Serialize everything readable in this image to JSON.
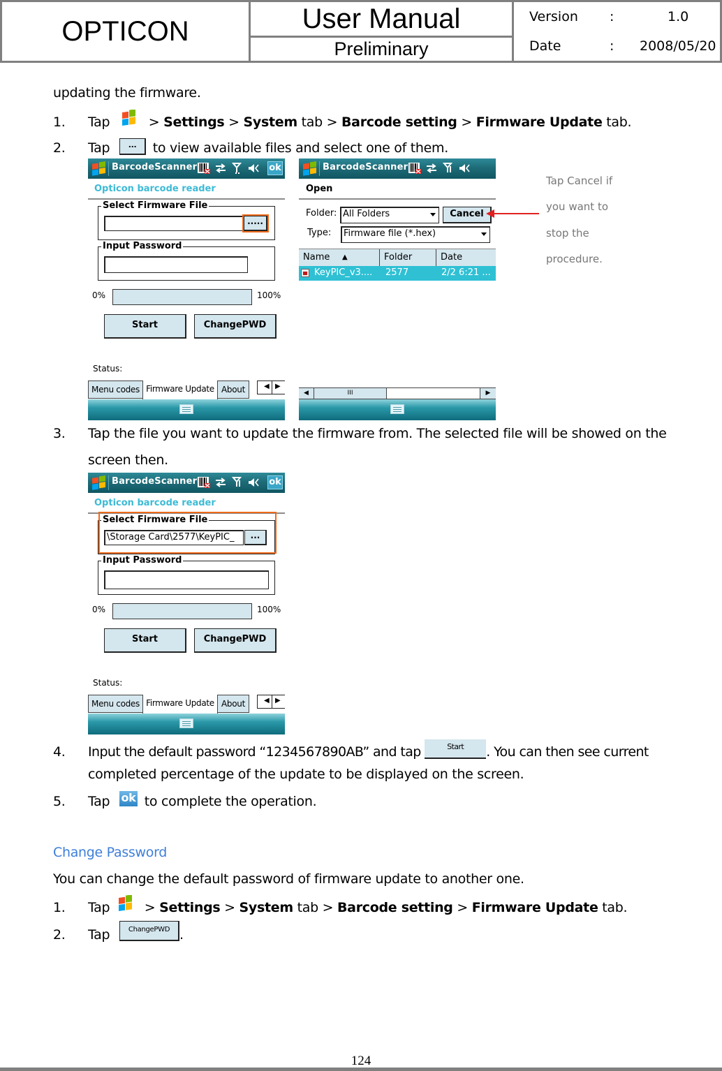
{
  "header": {
    "company": "OPTICON",
    "doc_title": "User Manual",
    "status": "Preliminary",
    "version_label": "Version",
    "version_sep": ":",
    "version_value": "1.0",
    "date_label": "Date",
    "date_sep": ":",
    "date_value": "2008/05/20"
  },
  "intro": "updating the firmware.",
  "steps_update": [
    {
      "num": "1.",
      "tap": "Tap",
      "sep1": " > ",
      "b1": "Settings",
      "sep2": " > ",
      "b2": "System",
      "t1": " tab > ",
      "b3": "Barcode setting",
      "sep3": " > ",
      "b4": "Firmware Update",
      "t2": " tab."
    },
    {
      "num": "2.",
      "tap": "Tap",
      "button_label": "...",
      "rest": " to view available files and select one of them."
    },
    {
      "num": "3.",
      "line1": "Tap the file you want to update the firmware from. The selected file will be showed on the",
      "line2": "screen then."
    },
    {
      "num": "4.",
      "pre": "Input the default password “1234567890AB” and tap ",
      "button_label": "Start",
      "post": ". You can then see current",
      "line2": "completed percentage of the update to be displayed on the screen."
    },
    {
      "num": "5.",
      "tap": "Tap",
      "ok_label": "ok",
      "rest": " to complete the operation."
    }
  ],
  "screen1": {
    "app_title": "BarcodeScanner",
    "ok_label": "ok",
    "subtitle": "Opticon barcode reader",
    "group_file_label": "Select Firmware File",
    "file_value": "",
    "browse_label": ".....",
    "group_pwd_label": "Input Password",
    "pwd_value": "",
    "progress_min": "0%",
    "progress_max": "100%",
    "progress_value": 0,
    "start_label": "Start",
    "changepwd_label": "ChangePWD",
    "status_label": "Status:",
    "tabs": [
      "Menu codes",
      "Firmware Update",
      "About"
    ],
    "active_tab": "Firmware Update"
  },
  "screen2": {
    "app_title": "BarcodeScanner",
    "subtitle": "Open",
    "folder_label": "Folder:",
    "folder_value": "All Folders",
    "cancel_label": "Cancel",
    "type_label": "Type:",
    "type_value": "Firmware file (*.hex)",
    "columns": [
      "Name",
      "Folder",
      "Date"
    ],
    "sort_indicator": "▲",
    "files": [
      {
        "name": "KeyPIC_v3....",
        "folder": "2577",
        "date": "2/2 6:21 ..."
      }
    ],
    "scroll_grip": "III"
  },
  "annotation": {
    "lines": [
      "Tap Cancel if",
      "you want to",
      "stop the",
      "procedure."
    ]
  },
  "screen3": {
    "app_title": "BarcodeScanner",
    "ok_label": "ok",
    "subtitle": "Opticon barcode reader",
    "group_file_label": "Select Firmware File",
    "file_value": "\\Storage Card\\2577\\KeyPIC_",
    "browse_label": "...",
    "group_pwd_label": "Input Password",
    "pwd_value": "",
    "progress_min": "0%",
    "progress_max": "100%",
    "progress_value": 0,
    "start_label": "Start",
    "changepwd_label": "ChangePWD",
    "status_label": "Status:",
    "tabs": [
      "Menu codes",
      "Firmware Update",
      "About"
    ],
    "active_tab": "Firmware Update"
  },
  "change_password": {
    "heading": "Change Password",
    "intro": "You can change the default password of firmware update to another one.",
    "steps": [
      {
        "num": "1.",
        "tap": "Tap",
        "sep1": " > ",
        "b1": "Settings",
        "sep2": " > ",
        "b2": "System",
        "t1": " tab > ",
        "b3": "Barcode setting",
        "sep3": " > ",
        "b4": "Firmware Update",
        "t2": " tab."
      },
      {
        "num": "2.",
        "tap": "Tap",
        "button_label": "ChangePWD",
        "rest": "."
      }
    ]
  },
  "footer": {
    "page_number": "124"
  },
  "colors": {
    "header_border": "#808080",
    "subtitle_cyan": "#3dbbd6",
    "highlight_orange": "#ef6b1c",
    "arrow_red": "#e02020",
    "heading_blue": "#3d7fd9",
    "button_fill": "#d4e6ee"
  }
}
